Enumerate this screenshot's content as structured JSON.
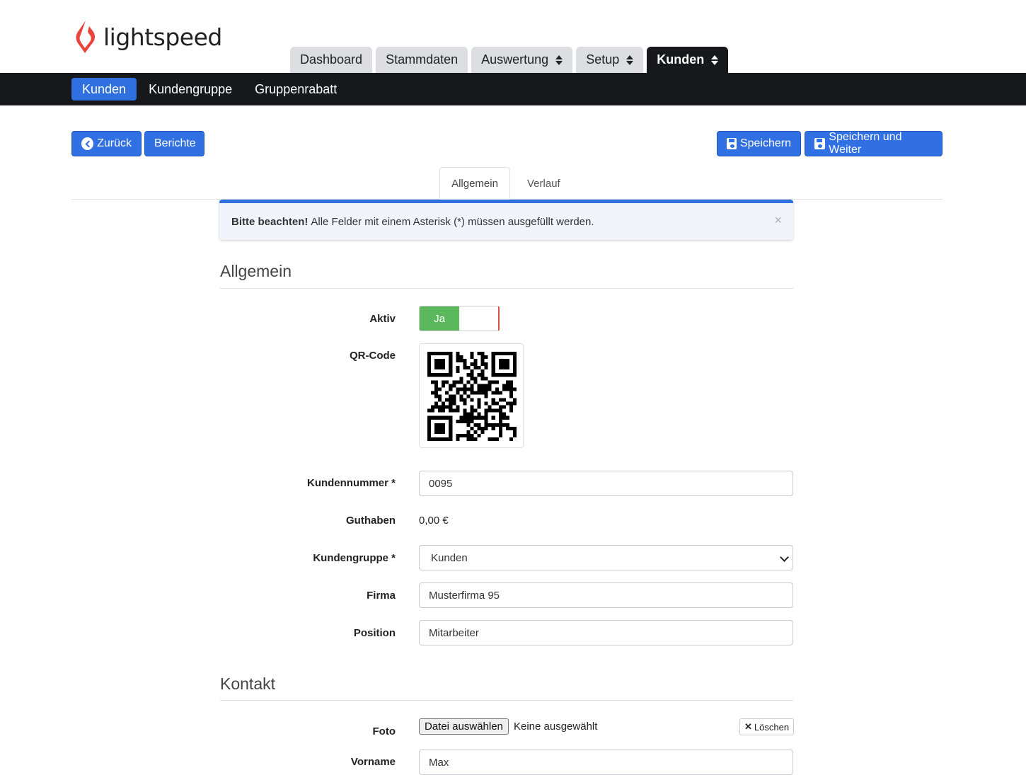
{
  "brand": {
    "name": "lightspeed",
    "color": "#e8443a"
  },
  "main_tabs": [
    {
      "label": "Dashboard"
    },
    {
      "label": "Stammdaten"
    },
    {
      "label": "Auswertung"
    },
    {
      "label": "Setup"
    },
    {
      "label": "Kunden"
    }
  ],
  "sub_nav": [
    {
      "label": "Kunden"
    },
    {
      "label": "Kundengruppe"
    },
    {
      "label": "Gruppenrabatt"
    }
  ],
  "actions": {
    "back_label": "Zurück",
    "reports_label": "Berichte",
    "save_label": "Speichern",
    "save_continue_label": "Speichern und Weiter"
  },
  "content_tabs": [
    {
      "label": "Allgemein"
    },
    {
      "label": "Verlauf"
    }
  ],
  "alert": {
    "strong": "Bitte beachten!",
    "text": "Alle Felder mit einem Asterisk (*) müssen ausgefüllt werden.",
    "close": "×"
  },
  "general": {
    "title": "Allgemein",
    "active_label": "Aktiv",
    "active_value": "Ja",
    "qr_label": "QR-Code",
    "customer_number_label": "Kundennummer *",
    "customer_number_value": "0095",
    "balance_label": "Guthaben",
    "balance_value": "0,00 €",
    "customer_group_label": "Kundengruppe *",
    "customer_group_value": "Kunden",
    "company_label": "Firma",
    "company_value": "Musterfirma 95",
    "position_label": "Position",
    "position_value": "Mitarbeiter"
  },
  "contact": {
    "title": "Kontakt",
    "photo_label": "Foto",
    "choose_file_label": "Datei auswählen",
    "no_file_text": "Keine ausgewählt",
    "delete_label": "Löschen",
    "firstname_label": "Vorname",
    "firstname_value": "Max"
  },
  "colors": {
    "accent": "#3070e2",
    "toggle_on": "#5cb85c",
    "nav_dark": "#16181b"
  }
}
